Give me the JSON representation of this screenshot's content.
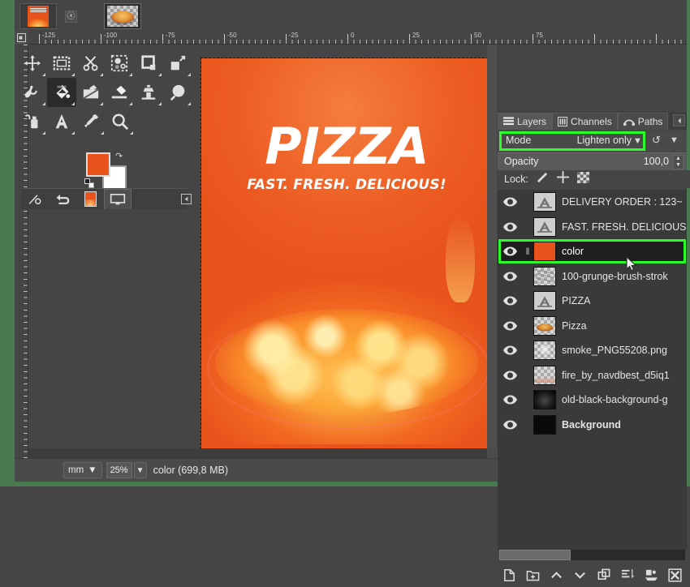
{
  "app": {
    "name": "GIMP",
    "image_tabs": [
      {
        "name": "poster-thumbnail",
        "label": ""
      },
      {
        "name": "pizza-thumbnail",
        "label": ""
      }
    ]
  },
  "rulers": {
    "unit": "mm",
    "h_labels": [
      "-125",
      "-100",
      "-75",
      "-50",
      "-25",
      "0",
      "25",
      "50",
      "75"
    ]
  },
  "toolbox": {
    "tools": [
      {
        "name": "move-tool",
        "label": "Move"
      },
      {
        "name": "rectangle-select-tool",
        "label": "Rectangle Select"
      },
      {
        "name": "scissors-select-tool",
        "label": "Scissors Select"
      },
      {
        "name": "fuzzy-select-tool",
        "label": "Fuzzy Select"
      },
      {
        "name": "crop-tool",
        "label": "Crop"
      },
      {
        "name": "scale-tool",
        "label": "Scale"
      },
      {
        "name": "smudge-tool",
        "label": "Smudge"
      },
      {
        "name": "bucket-fill-tool",
        "label": "Bucket Fill"
      },
      {
        "name": "gradient-tool",
        "label": "Gradient"
      },
      {
        "name": "eraser-tool",
        "label": "Eraser"
      },
      {
        "name": "clone-tool",
        "label": "Clone"
      },
      {
        "name": "paintbrush-tool",
        "label": "Paintbrush"
      },
      {
        "name": "ink-tool",
        "label": "Ink"
      },
      {
        "name": "text-tool",
        "label": "Text"
      },
      {
        "name": "color-picker-tool",
        "label": "Color Picker"
      },
      {
        "name": "zoom-tool",
        "label": "Zoom"
      }
    ],
    "active_tool": "bucket-fill-tool",
    "foreground_color": "#e8531c",
    "background_color": "#ffffff"
  },
  "canvas": {
    "poster": {
      "title": "PIZZA",
      "subtitle": "FAST. FRESH. DELICIOUS!",
      "background_color": "#e8531c",
      "text_color": "#ffffff"
    }
  },
  "dock": {
    "tabs": [
      {
        "label": "Layers",
        "icon": "layers-icon",
        "selected": true
      },
      {
        "label": "Channels",
        "icon": "channels-icon",
        "selected": false
      },
      {
        "label": "Paths",
        "icon": "paths-icon",
        "selected": false
      }
    ],
    "mode": {
      "label": "Mode",
      "value": "Lighten only",
      "highlight_color": "#2aff2a"
    },
    "opacity": {
      "label": "Opacity",
      "value": "100,0"
    },
    "lock": {
      "label": "Lock:",
      "items": [
        "lock-pixels-icon",
        "lock-position-icon",
        "lock-alpha-icon"
      ]
    },
    "layers": [
      {
        "name": "DELIVERY ORDER : 123~",
        "thumb": "text",
        "visible": true,
        "selected": false,
        "bold": false
      },
      {
        "name": "FAST. FRESH. DELICIOUS",
        "thumb": "text",
        "visible": true,
        "selected": false,
        "bold": false
      },
      {
        "name": "color",
        "thumb": "solid-orange",
        "visible": true,
        "selected": true,
        "bold": false
      },
      {
        "name": "100-grunge-brush-strok",
        "thumb": "grunge",
        "visible": true,
        "selected": false,
        "bold": false
      },
      {
        "name": "PIZZA",
        "thumb": "text",
        "visible": true,
        "selected": false,
        "bold": false
      },
      {
        "name": "Pizza",
        "thumb": "pizza",
        "visible": true,
        "selected": false,
        "bold": false
      },
      {
        "name": "smoke_PNG55208.png",
        "thumb": "smoke",
        "visible": true,
        "selected": false,
        "bold": false
      },
      {
        "name": "fire_by_navdbest_d5iq1",
        "thumb": "fire",
        "visible": true,
        "selected": false,
        "bold": false
      },
      {
        "name": "old-black-background-g",
        "thumb": "blackgrad",
        "visible": true,
        "selected": false,
        "bold": false
      },
      {
        "name": "Background",
        "thumb": "black",
        "visible": true,
        "selected": false,
        "bold": true
      }
    ],
    "bottom_buttons": [
      {
        "name": "new-layer-button",
        "icon": "new-layer-icon"
      },
      {
        "name": "new-layer-group-button",
        "icon": "new-layer-group-icon"
      },
      {
        "name": "raise-layer-button",
        "icon": "chevron-up-icon"
      },
      {
        "name": "lower-layer-button",
        "icon": "chevron-down-icon"
      },
      {
        "name": "duplicate-layer-button",
        "icon": "duplicate-icon"
      },
      {
        "name": "merge-down-button",
        "icon": "merge-down-icon"
      },
      {
        "name": "anchor-layer-button",
        "icon": "anchor-icon"
      },
      {
        "name": "delete-layer-button",
        "icon": "delete-icon"
      }
    ]
  },
  "statusbar": {
    "unit": "mm",
    "zoom": "25%",
    "message": "color (699,8 MB)"
  }
}
